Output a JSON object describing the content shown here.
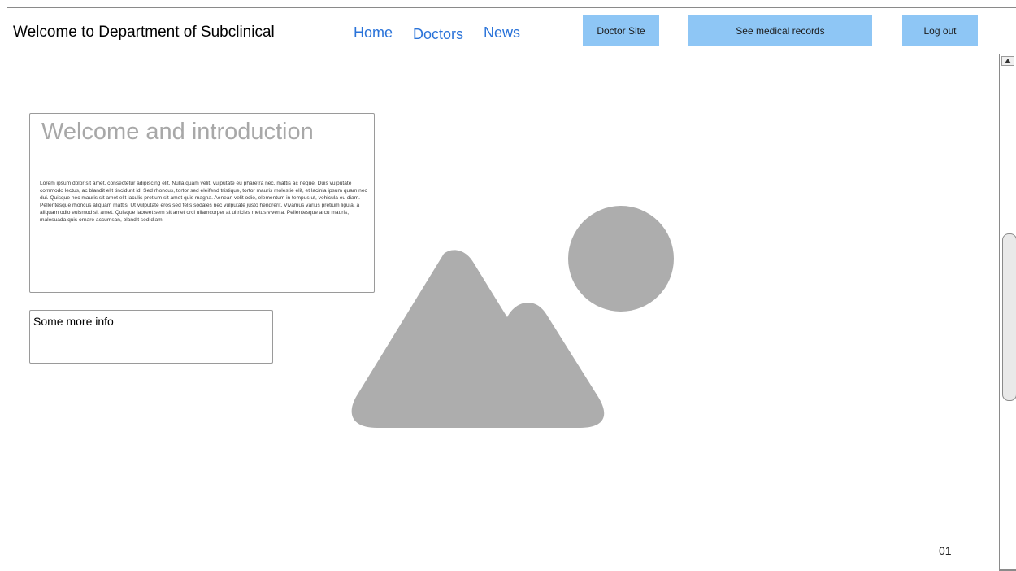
{
  "header": {
    "title": "Welcome to Department of Subclinical",
    "nav": {
      "home": "Home",
      "doctors": "Doctors",
      "news": "News"
    },
    "buttons": {
      "doctor_site": "Doctor Site",
      "medical_records": "See medical records",
      "logout": "Log out"
    }
  },
  "intro": {
    "title": "Welcome and introduction",
    "body": "Lorem ipsum dolor sit amet, consectetur adipiscing elit. Nulla quam velit, vulputate eu pharetra nec, mattis ac neque. Duis vulputate commodo lectus, ac blandit elit tincidunt id. Sed rhoncus, tortor sed eleifend tristique, tortor mauris molestie elit, et lacinia ipsum quam nec dui. Quisque nec mauris sit amet elit iaculis pretium sit amet quis magna. Aenean velit odio, elementum in tempus ut, vehicula eu diam. Pellentesque rhoncus aliquam mattis. Ut vulputate eros sed felis sodales nec vulputate justo hendrerit. Vivamus varius pretium ligula, a aliquam odio euismod sit amet. Quisque laoreet sem sit amet orci ullamcorper at ultricies metus viverra. Pellentesque arcu mauris, malesuada quis ornare accumsan, blandit sed diam."
  },
  "more_info": {
    "text": "Some more info"
  },
  "image_placeholder": {
    "icon": "image-placeholder-icon",
    "color": "#adadad"
  },
  "page_number": "01",
  "colors": {
    "nav_link": "#2a73d9",
    "button_bg": "#8ec6f5",
    "border": "#8a8a8a",
    "placeholder_gray": "#adadad"
  }
}
